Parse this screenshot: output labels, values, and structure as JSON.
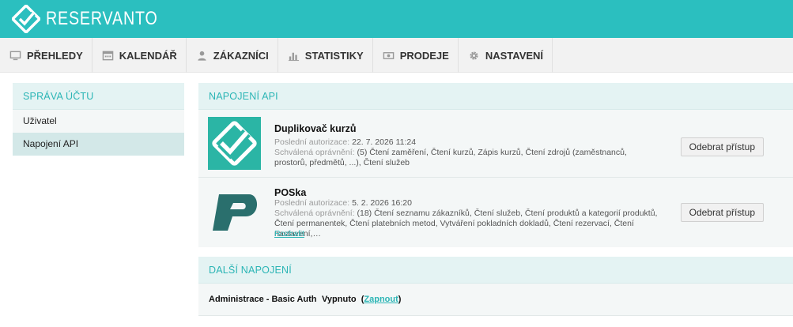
{
  "brand": {
    "name": "RESERVANTO"
  },
  "nav": [
    {
      "label": "PŘEHLEDY",
      "icon": "monitor-icon"
    },
    {
      "label": "KALENDÁŘ",
      "icon": "calendar-icon"
    },
    {
      "label": "ZÁKAZNÍCI",
      "icon": "user-icon"
    },
    {
      "label": "STATISTIKY",
      "icon": "bar-chart-icon"
    },
    {
      "label": "PRODEJE",
      "icon": "cash-icon"
    },
    {
      "label": "NASTAVENÍ",
      "icon": "gear-icon"
    }
  ],
  "sidebar": {
    "title": "SPRÁVA ÚČTU",
    "items": [
      {
        "label": "Uživatel"
      },
      {
        "label": "Napojení API"
      }
    ]
  },
  "api": {
    "title": "NAPOJENÍ API",
    "last_auth_label": "Poslední autorizace:",
    "perm_label": "Schválená oprávnění:",
    "items": [
      {
        "name": "Duplikovač kurzů",
        "last_auth": "22. 7. 2026 11:24",
        "permissions": "(5) Čtení zaměření, Čtení kurzů, Zápis kurzů, Čtení zdrojů (zaměstnanců, prostorů, předmětů, ...), Čtení služeb",
        "button": "Odebrat přístup"
      },
      {
        "name": "POSka",
        "last_auth": "5. 2. 2026 16:20",
        "permissions": "(18) Čtení seznamu zákazníků, Čtení služeb, Čtení produktů a kategorií produktů, Čtení permanentek, Čtení platebních metod, Vytváření pokladních dokladů, Čtení rezervací, Čtení nastavení,…",
        "expand": "Rozbalit",
        "button": "Odebrat přístup"
      }
    ]
  },
  "other": {
    "title": "DALŠÍ NAPOJENÍ",
    "row": {
      "name": "Administrace - Basic Auth",
      "status": "Vypnuto",
      "open_paren": "(",
      "action": "Zapnout",
      "close_paren": ")"
    }
  },
  "colors": {
    "accent": "#2bbfbf",
    "app_logo_green": "#2bb5a5",
    "poska_logo": "#2a6f6d"
  }
}
